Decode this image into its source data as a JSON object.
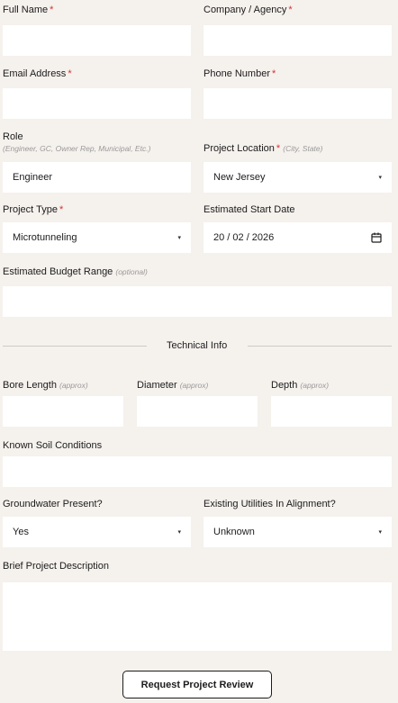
{
  "form": {
    "full_name": {
      "label": "Full Name",
      "value": ""
    },
    "company": {
      "label": "Company / Agency",
      "value": ""
    },
    "email": {
      "label": "Email Address",
      "value": ""
    },
    "phone": {
      "label": "Phone Number",
      "value": ""
    },
    "role": {
      "label": "Role",
      "hint": "(Engineer, GC, Owner Rep, Municipal, Etc.)",
      "value": "Engineer"
    },
    "location": {
      "label": "Project Location",
      "hint": "(City, State)",
      "value": "New Jersey"
    },
    "project_type": {
      "label": "Project Type",
      "value": "Microtunneling"
    },
    "start_date": {
      "label": "Estimated Start Date",
      "value": "20 / 02 / 2026"
    },
    "budget": {
      "label": "Estimated Budget Range",
      "hint": "(optional)",
      "value": ""
    },
    "required_marker": "*",
    "caret": "▾"
  },
  "technical": {
    "section_title": "Technical Info",
    "bore_length": {
      "label": "Bore Length",
      "hint": "(approx)",
      "value": ""
    },
    "diameter": {
      "label": "Diameter",
      "hint": "(approx)",
      "value": ""
    },
    "depth": {
      "label": "Depth",
      "hint": "(approx)",
      "value": ""
    },
    "soil": {
      "label": "Known Soil Conditions",
      "value": ""
    },
    "groundwater": {
      "label": "Groundwater Present?",
      "value": "Yes"
    },
    "utilities": {
      "label": "Existing Utilities In Alignment?",
      "value": "Unknown"
    },
    "description": {
      "label": "Brief Project Description",
      "value": ""
    }
  },
  "submit_label": "Request Project Review",
  "colors": {
    "background": "#f5f1ed",
    "required": "#d9302e",
    "field": "#ffffff"
  },
  "icons": {
    "date": "calendar-icon",
    "select": "chevron-down-icon"
  }
}
